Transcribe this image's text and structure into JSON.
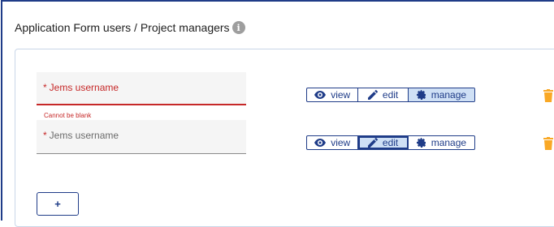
{
  "section": {
    "title": "Application Form users / Project managers",
    "info_icon": "info-icon"
  },
  "users": [
    {
      "field_label": "Jems username",
      "value": "",
      "required_marker": "*",
      "error": "Cannot be blank",
      "permission": {
        "options": [
          "view",
          "edit",
          "manage"
        ],
        "selected": "manage"
      }
    },
    {
      "field_label": "Jems username",
      "value": "",
      "required_marker": "*",
      "error": "",
      "permission": {
        "options": [
          "view",
          "edit",
          "manage"
        ],
        "selected": "edit"
      }
    }
  ],
  "add_button": {
    "label": "+"
  },
  "colors": {
    "primary": "#1f3c88",
    "error": "#c62828",
    "selected_bg": "#cfe0f5",
    "delete": "#f9a825"
  }
}
